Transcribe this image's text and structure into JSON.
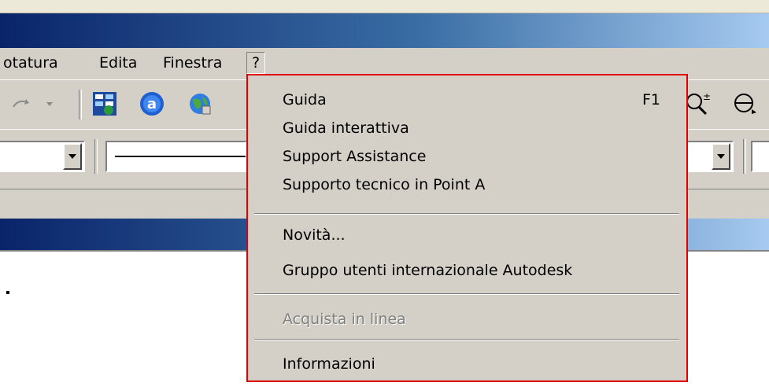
{
  "menubar": {
    "items": [
      {
        "label": "otatura"
      },
      {
        "label": "Edita"
      },
      {
        "label": "Finestra"
      },
      {
        "label": "?"
      }
    ]
  },
  "help_menu": {
    "items": [
      {
        "label": "Guida",
        "shortcut": "F1"
      },
      {
        "label": "Guida interattiva"
      },
      {
        "label": "Support Assistance"
      },
      {
        "label": "Supporto tecnico in Point A"
      },
      {
        "label": "Novità..."
      },
      {
        "label": "Gruppo utenti internazionale Autodesk"
      },
      {
        "label": "Acquista in linea",
        "disabled": true
      },
      {
        "label": "Informazioni"
      }
    ]
  },
  "icons": {
    "toolbar": [
      "redo-icon",
      "layers-icon",
      "autodesk-a-icon",
      "globe-icon",
      "zoom-realtime-icon",
      "3d-orbit-icon"
    ]
  },
  "colors": {
    "title_bar_start": "#0a246a",
    "title_bar_end": "#a6caf0",
    "menu_border": "#e00000",
    "face": "#d4d0c8"
  }
}
